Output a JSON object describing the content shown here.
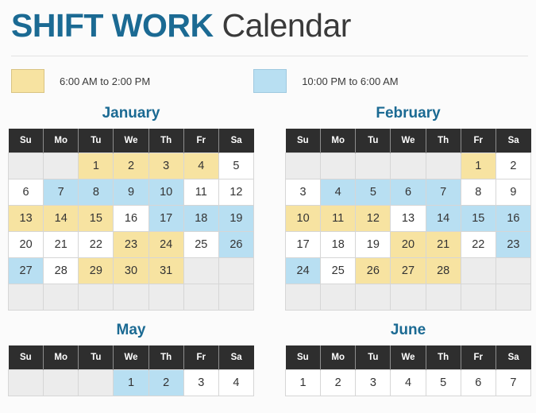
{
  "title": {
    "strong": "SHIFT WORK",
    "light": " Calendar"
  },
  "legend": {
    "items": [
      {
        "swatch": "day-shift-swatch",
        "color": "#f7e3a1",
        "label": "6:00 AM to 2:00 PM"
      },
      {
        "swatch": "night-shift-swatch",
        "color": "#b8dff2",
        "label": "10:00 PM to 6:00 AM"
      }
    ]
  },
  "weekday_headers": [
    "Su",
    "Mo",
    "Tu",
    "We",
    "Th",
    "Fr",
    "Sa"
  ],
  "colors": {
    "accent": "#1b6a93",
    "header_bg": "#2e2e2e",
    "day_shift": "#f7e3a1",
    "night_shift": "#b8dff2",
    "empty_cell": "#ececec",
    "page_bg": "#fbfbfb"
  },
  "months": [
    {
      "name": "January",
      "weeks": [
        [
          {
            "n": "",
            "s": "empty"
          },
          {
            "n": "",
            "s": "empty"
          },
          {
            "n": "1",
            "s": "day"
          },
          {
            "n": "2",
            "s": "day"
          },
          {
            "n": "3",
            "s": "day"
          },
          {
            "n": "4",
            "s": "day"
          },
          {
            "n": "5",
            "s": "none"
          }
        ],
        [
          {
            "n": "6",
            "s": "none"
          },
          {
            "n": "7",
            "s": "night"
          },
          {
            "n": "8",
            "s": "night"
          },
          {
            "n": "9",
            "s": "night"
          },
          {
            "n": "10",
            "s": "night"
          },
          {
            "n": "11",
            "s": "none"
          },
          {
            "n": "12",
            "s": "none"
          }
        ],
        [
          {
            "n": "13",
            "s": "day"
          },
          {
            "n": "14",
            "s": "day"
          },
          {
            "n": "15",
            "s": "day"
          },
          {
            "n": "16",
            "s": "none"
          },
          {
            "n": "17",
            "s": "night"
          },
          {
            "n": "18",
            "s": "night"
          },
          {
            "n": "19",
            "s": "night"
          }
        ],
        [
          {
            "n": "20",
            "s": "none"
          },
          {
            "n": "21",
            "s": "none"
          },
          {
            "n": "22",
            "s": "none"
          },
          {
            "n": "23",
            "s": "day"
          },
          {
            "n": "24",
            "s": "day"
          },
          {
            "n": "25",
            "s": "none"
          },
          {
            "n": "26",
            "s": "night"
          }
        ],
        [
          {
            "n": "27",
            "s": "night"
          },
          {
            "n": "28",
            "s": "none"
          },
          {
            "n": "29",
            "s": "day"
          },
          {
            "n": "30",
            "s": "day"
          },
          {
            "n": "31",
            "s": "day"
          },
          {
            "n": "",
            "s": "empty"
          },
          {
            "n": "",
            "s": "empty"
          }
        ],
        [
          {
            "n": "",
            "s": "empty"
          },
          {
            "n": "",
            "s": "empty"
          },
          {
            "n": "",
            "s": "empty"
          },
          {
            "n": "",
            "s": "empty"
          },
          {
            "n": "",
            "s": "empty"
          },
          {
            "n": "",
            "s": "empty"
          },
          {
            "n": "",
            "s": "empty"
          }
        ]
      ]
    },
    {
      "name": "February",
      "weeks": [
        [
          {
            "n": "",
            "s": "empty"
          },
          {
            "n": "",
            "s": "empty"
          },
          {
            "n": "",
            "s": "empty"
          },
          {
            "n": "",
            "s": "empty"
          },
          {
            "n": "",
            "s": "empty"
          },
          {
            "n": "1",
            "s": "day"
          },
          {
            "n": "2",
            "s": "none"
          }
        ],
        [
          {
            "n": "3",
            "s": "none"
          },
          {
            "n": "4",
            "s": "night"
          },
          {
            "n": "5",
            "s": "night"
          },
          {
            "n": "6",
            "s": "night"
          },
          {
            "n": "7",
            "s": "night"
          },
          {
            "n": "8",
            "s": "none"
          },
          {
            "n": "9",
            "s": "none"
          }
        ],
        [
          {
            "n": "10",
            "s": "day"
          },
          {
            "n": "11",
            "s": "day"
          },
          {
            "n": "12",
            "s": "day"
          },
          {
            "n": "13",
            "s": "none"
          },
          {
            "n": "14",
            "s": "night"
          },
          {
            "n": "15",
            "s": "night"
          },
          {
            "n": "16",
            "s": "night"
          }
        ],
        [
          {
            "n": "17",
            "s": "none"
          },
          {
            "n": "18",
            "s": "none"
          },
          {
            "n": "19",
            "s": "none"
          },
          {
            "n": "20",
            "s": "day"
          },
          {
            "n": "21",
            "s": "day"
          },
          {
            "n": "22",
            "s": "none"
          },
          {
            "n": "23",
            "s": "night"
          }
        ],
        [
          {
            "n": "24",
            "s": "night"
          },
          {
            "n": "25",
            "s": "none"
          },
          {
            "n": "26",
            "s": "day"
          },
          {
            "n": "27",
            "s": "day"
          },
          {
            "n": "28",
            "s": "day"
          },
          {
            "n": "",
            "s": "empty"
          },
          {
            "n": "",
            "s": "empty"
          }
        ],
        [
          {
            "n": "",
            "s": "empty"
          },
          {
            "n": "",
            "s": "empty"
          },
          {
            "n": "",
            "s": "empty"
          },
          {
            "n": "",
            "s": "empty"
          },
          {
            "n": "",
            "s": "empty"
          },
          {
            "n": "",
            "s": "empty"
          },
          {
            "n": "",
            "s": "empty"
          }
        ]
      ]
    },
    {
      "name": "May",
      "weeks": [
        [
          {
            "n": "",
            "s": "empty"
          },
          {
            "n": "",
            "s": "empty"
          },
          {
            "n": "",
            "s": "empty"
          },
          {
            "n": "1",
            "s": "night"
          },
          {
            "n": "2",
            "s": "night"
          },
          {
            "n": "3",
            "s": "none"
          },
          {
            "n": "4",
            "s": "none"
          }
        ]
      ]
    },
    {
      "name": "June",
      "weeks": [
        [
          {
            "n": "1",
            "s": "none"
          },
          {
            "n": "2",
            "s": "none"
          },
          {
            "n": "3",
            "s": "none"
          },
          {
            "n": "4",
            "s": "none"
          },
          {
            "n": "5",
            "s": "none"
          },
          {
            "n": "6",
            "s": "none"
          },
          {
            "n": "7",
            "s": "none"
          }
        ]
      ]
    }
  ]
}
